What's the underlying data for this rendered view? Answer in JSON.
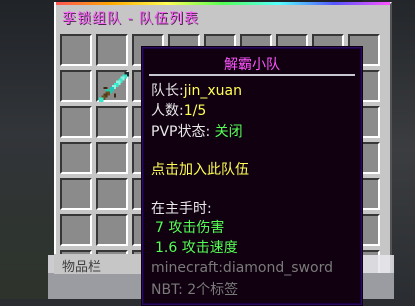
{
  "window": {
    "title": "孪锁组队 - 队伍列表"
  },
  "inventory": {
    "label": "物品栏"
  },
  "slot_item": {
    "icon": "diamond-sword-icon"
  },
  "tooltip": {
    "title": "解霸小队",
    "leader_label": "队长:",
    "leader_value": "jin_xuan",
    "count_label": "人数:",
    "count_value": "1/5",
    "pvp_label": "PVP状态:",
    "pvp_value": "关闭",
    "join_text": "点击加入此队伍",
    "main_hand_label": "在主手时:",
    "attack_damage": "7 攻击伤害",
    "attack_speed": "1.6 攻击速度",
    "item_id": "minecraft:diamond_sword",
    "nbt": "NBT: 2个标签"
  },
  "colors": {
    "title_magenta": "#ff55ff",
    "value_yellow": "#ffff55",
    "stat_green": "#55ff55",
    "meta_gray": "#7a7a7a",
    "tooltip_bg": "#100010",
    "tooltip_border": "#2a0a5a"
  }
}
